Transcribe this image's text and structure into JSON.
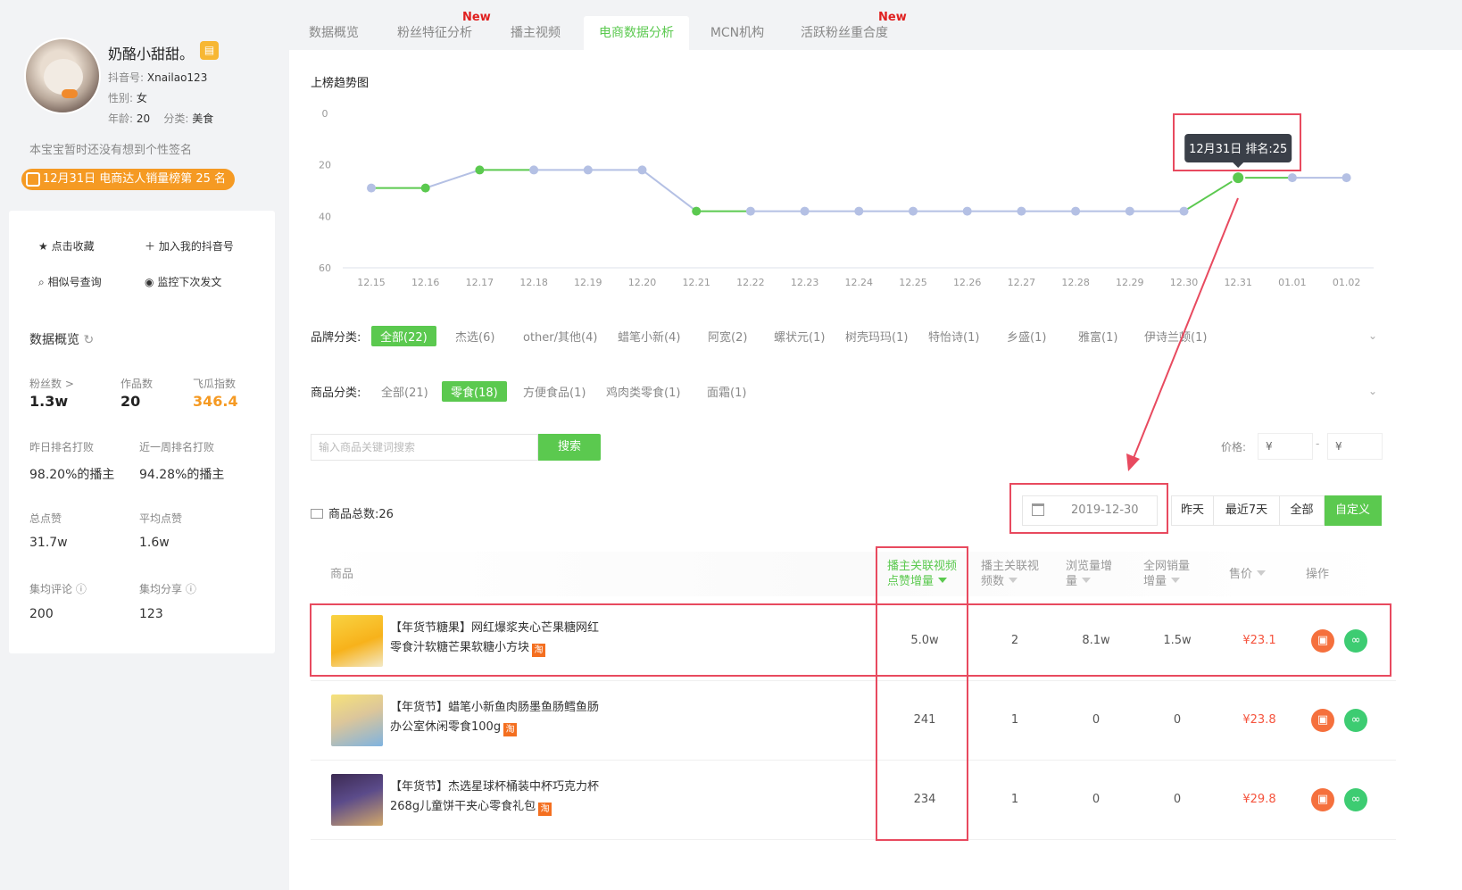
{
  "profile": {
    "name": "奶酪小甜甜。",
    "douyin_label": "抖音号:",
    "douyin_id": "Xnailao123",
    "gender_label": "性别:",
    "gender": "女",
    "age_label": "年龄:",
    "age": "20",
    "category_label": "分类:",
    "category": "美食",
    "signature": "本宝宝暂时还没有想到个性签名",
    "rank_badge": "12月31日 电商达人销量榜第 25 名"
  },
  "actions": {
    "favorite": "点击收藏",
    "add": "加入我的抖音号",
    "similar": "相似号查询",
    "monitor": "监控下次发文"
  },
  "overview": {
    "title": "数据概览",
    "fans_label": "粉丝数 >",
    "fans": "1.3w",
    "works_label": "作品数",
    "works": "20",
    "index_label": "飞瓜指数",
    "index": "346.4",
    "yesterday_label": "昨日排名打败",
    "yesterday": "98.20%的播主",
    "week_label": "近一周排名打败",
    "week": "94.28%的播主",
    "likes_label": "总点赞",
    "likes": "31.7w",
    "avg_likes_label": "平均点赞",
    "avg_likes": "1.6w",
    "avg_comments_label": "集均评论 ⓘ",
    "avg_comments": "200",
    "avg_shares_label": "集均分享 ⓘ",
    "avg_shares": "123"
  },
  "tabs": [
    {
      "label": "数据概览"
    },
    {
      "label": "粉丝特征分析"
    },
    {
      "label": "播主视频"
    },
    {
      "label": "电商数据分析"
    },
    {
      "label": "MCN机构"
    },
    {
      "label": "活跃粉丝重合度"
    }
  ],
  "new_tag": "New",
  "chart_title": "上榜趋势图",
  "chart_data": {
    "type": "line",
    "title": "",
    "x": [
      "12.15",
      "12.16",
      "12.17",
      "12.18",
      "12.19",
      "12.20",
      "12.21",
      "12.22",
      "12.23",
      "12.24",
      "12.25",
      "12.26",
      "12.27",
      "12.28",
      "12.29",
      "12.30",
      "12.31",
      "01.01",
      "01.02"
    ],
    "series": [
      {
        "values": [
          29,
          29,
          22,
          22,
          22,
          22,
          38,
          38,
          38,
          38,
          38,
          38,
          38,
          38,
          38,
          38,
          25,
          25,
          25
        ]
      }
    ],
    "highlight": [
      false,
      true,
      true,
      false,
      false,
      false,
      true,
      false,
      false,
      false,
      false,
      false,
      false,
      false,
      false,
      false,
      true,
      false,
      false
    ],
    "yticks": [
      "0",
      "20",
      "40",
      "60"
    ],
    "ylim": [
      0,
      60
    ],
    "y_inverted": true,
    "tooltip": "12月31日 排名:25",
    "colors": {
      "highlight": "#5bc94f",
      "normal": "#b4c0e4"
    }
  },
  "brand_filter": {
    "label": "品牌分类:",
    "options": [
      "全部(22)",
      "杰选(6)",
      "other/其他(4)",
      "蜡笔小新(4)",
      "阿宽(2)",
      "螺状元(1)",
      "树壳玛玛(1)",
      "特怡诗(1)",
      "乡盛(1)",
      "雅富(1)",
      "伊诗兰顿(1)"
    ]
  },
  "product_filter": {
    "label": "商品分类:",
    "options": [
      "全部(21)",
      "零食(18)",
      "方便食品(1)",
      "鸡肉类零食(1)",
      "面霜(1)"
    ]
  },
  "search": {
    "placeholder": "输入商品关键词搜索",
    "button": "搜索"
  },
  "price": {
    "label": "价格:",
    "min": "¥",
    "max": "¥",
    "dash": "-"
  },
  "total": "商品总数:26",
  "date_value": "2019-12-30",
  "segments": [
    "昨天",
    "最近7天",
    "全部",
    "自定义"
  ],
  "table": {
    "headers": {
      "product": "商品",
      "col1": "播主关联视频点赞增量",
      "col2": "播主关联视频数",
      "col3": "浏览量增量",
      "col4": "全网销量增量",
      "col5": "售价",
      "col6": "操作"
    },
    "rows": [
      {
        "title": "【年货节糖果】网红爆浆夹心芒果糖网红零食汁软糖芒果软糖小方块",
        "likes": "5.0w",
        "videos": "2",
        "views": "8.1w",
        "sales": "1.5w",
        "price": "¥23.1"
      },
      {
        "title": "【年货节】蜡笔小新鱼肉肠墨鱼肠鳕鱼肠办公室休闲零食100g",
        "likes": "241",
        "videos": "1",
        "views": "0",
        "sales": "0",
        "price": "¥23.8"
      },
      {
        "title": "【年货节】杰选星球杯桶装中杯巧克力杯268g儿童饼干夹心零食礼包",
        "likes": "234",
        "videos": "1",
        "views": "0",
        "sales": "0",
        "price": "¥29.8"
      }
    ],
    "tb_label": "淘"
  }
}
